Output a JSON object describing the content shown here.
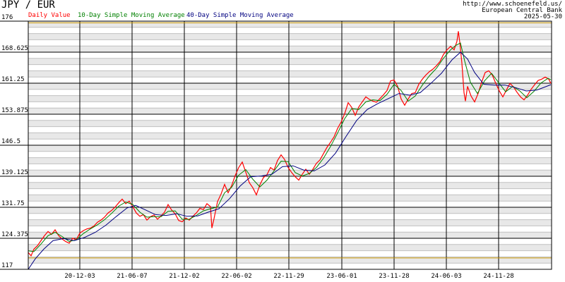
{
  "chart_data": {
    "type": "line",
    "title": "JPY / EUR",
    "source_url": "http://www.schoenefeld.us/",
    "source_name": "European Central Bank",
    "date": "2025-05-30",
    "ylim": [
      117,
      176
    ],
    "y_ticks": [
      "176",
      "168.625",
      "161.25",
      "153.875",
      "146.5",
      "139.125",
      "131.75",
      "124.375",
      "117"
    ],
    "x_ticks": [
      "20-12-03",
      "21-06-07",
      "21-12-02",
      "22-06-02",
      "22-11-29",
      "23-06-01",
      "23-11-28",
      "24-06-03",
      "24-11-28"
    ],
    "reference_lines": [
      175.6,
      119.7
    ],
    "colors": {
      "daily": "#ff0000",
      "sma10": "#008000",
      "sma40": "#000080",
      "grid_major": "#000000",
      "grid_minor": "#c0c0c0",
      "band": "#e8e8e8",
      "reference": "#cc9900"
    },
    "series": [
      {
        "name": "Daily Value",
        "values": [
          [
            0,
            121.0
          ],
          [
            4,
            120.2
          ],
          [
            8,
            121.8
          ],
          [
            13,
            122.6
          ],
          [
            18,
            123.8
          ],
          [
            23,
            125.0
          ],
          [
            28,
            126.0
          ],
          [
            33,
            125.3
          ],
          [
            38,
            126.4
          ],
          [
            43,
            125.0
          ],
          [
            48,
            124.2
          ],
          [
            53,
            123.6
          ],
          [
            58,
            123.2
          ],
          [
            63,
            124.4
          ],
          [
            68,
            124.0
          ],
          [
            73,
            125.6
          ],
          [
            78,
            126.2
          ],
          [
            83,
            126.6
          ],
          [
            88,
            126.8
          ],
          [
            93,
            127.3
          ],
          [
            98,
            128.2
          ],
          [
            103,
            128.7
          ],
          [
            108,
            129.4
          ],
          [
            113,
            130.4
          ],
          [
            118,
            131.0
          ],
          [
            123,
            131.8
          ],
          [
            128,
            132.8
          ],
          [
            133,
            133.7
          ],
          [
            138,
            132.6
          ],
          [
            143,
            133.2
          ],
          [
            148,
            131.9
          ],
          [
            153,
            130.4
          ],
          [
            158,
            129.6
          ],
          [
            163,
            130.0
          ],
          [
            168,
            128.7
          ],
          [
            173,
            129.5
          ],
          [
            178,
            129.9
          ],
          [
            183,
            128.9
          ],
          [
            188,
            129.7
          ],
          [
            193,
            130.6
          ],
          [
            198,
            132.4
          ],
          [
            203,
            131.1
          ],
          [
            208,
            130.2
          ],
          [
            213,
            128.6
          ],
          [
            218,
            128.3
          ],
          [
            223,
            129.2
          ],
          [
            228,
            128.7
          ],
          [
            233,
            129.6
          ],
          [
            238,
            130.4
          ],
          [
            243,
            131.5
          ],
          [
            248,
            131.2
          ],
          [
            253,
            132.6
          ],
          [
            258,
            131.9
          ],
          [
            260,
            126.8
          ],
          [
            263,
            129.0
          ],
          [
            268,
            133.1
          ],
          [
            273,
            134.9
          ],
          [
            278,
            137.2
          ],
          [
            283,
            135.2
          ],
          [
            288,
            136.9
          ],
          [
            293,
            139.3
          ],
          [
            298,
            141.2
          ],
          [
            303,
            142.5
          ],
          [
            308,
            140.1
          ],
          [
            313,
            137.6
          ],
          [
            318,
            136.4
          ],
          [
            323,
            134.7
          ],
          [
            328,
            137.1
          ],
          [
            333,
            138.8
          ],
          [
            338,
            139.5
          ],
          [
            343,
            141.2
          ],
          [
            348,
            140.6
          ],
          [
            353,
            142.9
          ],
          [
            358,
            144.2
          ],
          [
            363,
            143.1
          ],
          [
            368,
            141.2
          ],
          [
            373,
            140.0
          ],
          [
            378,
            139.0
          ],
          [
            383,
            138.2
          ],
          [
            388,
            139.6
          ],
          [
            393,
            140.8
          ],
          [
            398,
            139.6
          ],
          [
            403,
            140.8
          ],
          [
            408,
            142.2
          ],
          [
            413,
            143.0
          ],
          [
            418,
            144.5
          ],
          [
            423,
            146.0
          ],
          [
            428,
            147.2
          ],
          [
            433,
            148.5
          ],
          [
            438,
            150.5
          ],
          [
            443,
            152.0
          ],
          [
            448,
            154.0
          ],
          [
            453,
            156.6
          ],
          [
            458,
            155.5
          ],
          [
            463,
            153.6
          ],
          [
            468,
            155.6
          ],
          [
            473,
            156.8
          ],
          [
            478,
            158.0
          ],
          [
            483,
            157.4
          ],
          [
            488,
            157.0
          ],
          [
            493,
            156.7
          ],
          [
            498,
            157.6
          ],
          [
            503,
            158.5
          ],
          [
            508,
            159.5
          ],
          [
            513,
            161.8
          ],
          [
            518,
            162.0
          ],
          [
            523,
            160.5
          ],
          [
            528,
            157.5
          ],
          [
            533,
            156.0
          ],
          [
            538,
            157.5
          ],
          [
            543,
            158.8
          ],
          [
            548,
            159.0
          ],
          [
            553,
            161.0
          ],
          [
            558,
            162.2
          ],
          [
            563,
            163.2
          ],
          [
            568,
            164.0
          ],
          [
            573,
            164.6
          ],
          [
            578,
            165.4
          ],
          [
            583,
            166.4
          ],
          [
            588,
            168.1
          ],
          [
            593,
            169.2
          ],
          [
            598,
            170.0
          ],
          [
            603,
            169.2
          ],
          [
            607,
            171.2
          ],
          [
            609,
            173.6
          ],
          [
            611,
            171.0
          ],
          [
            614,
            166.0
          ],
          [
            617,
            159.0
          ],
          [
            619,
            157.0
          ],
          [
            622,
            160.5
          ],
          [
            627,
            158.2
          ],
          [
            632,
            156.8
          ],
          [
            637,
            158.8
          ],
          [
            642,
            161.5
          ],
          [
            647,
            163.8
          ],
          [
            652,
            164.2
          ],
          [
            657,
            163.2
          ],
          [
            662,
            161.2
          ],
          [
            667,
            159.4
          ],
          [
            672,
            158.0
          ],
          [
            677,
            159.6
          ],
          [
            682,
            161.2
          ],
          [
            687,
            160.4
          ],
          [
            692,
            159.1
          ],
          [
            697,
            158.0
          ],
          [
            702,
            157.3
          ],
          [
            707,
            158.4
          ],
          [
            712,
            159.8
          ],
          [
            717,
            160.9
          ],
          [
            722,
            161.9
          ],
          [
            727,
            162.2
          ],
          [
            732,
            162.7
          ],
          [
            737,
            162.2
          ],
          [
            740,
            161.2
          ]
        ]
      },
      {
        "name": "10-Day Simple Moving Average",
        "values": [
          [
            0,
            121.4
          ],
          [
            8,
            121.2
          ],
          [
            18,
            123.0
          ],
          [
            28,
            125.0
          ],
          [
            38,
            125.8
          ],
          [
            48,
            124.8
          ],
          [
            58,
            123.6
          ],
          [
            68,
            124.0
          ],
          [
            78,
            125.5
          ],
          [
            88,
            126.6
          ],
          [
            98,
            127.6
          ],
          [
            108,
            128.8
          ],
          [
            118,
            130.3
          ],
          [
            128,
            132.0
          ],
          [
            138,
            133.0
          ],
          [
            148,
            132.4
          ],
          [
            158,
            130.6
          ],
          [
            168,
            129.4
          ],
          [
            178,
            129.5
          ],
          [
            188,
            129.5
          ],
          [
            198,
            130.8
          ],
          [
            208,
            130.9
          ],
          [
            218,
            128.9
          ],
          [
            228,
            128.9
          ],
          [
            238,
            129.8
          ],
          [
            248,
            130.9
          ],
          [
            258,
            131.4
          ],
          [
            268,
            131.8
          ],
          [
            278,
            135.2
          ],
          [
            288,
            136.5
          ],
          [
            298,
            139.4
          ],
          [
            308,
            140.7
          ],
          [
            318,
            138.4
          ],
          [
            328,
            136.6
          ],
          [
            338,
            138.2
          ],
          [
            348,
            140.4
          ],
          [
            358,
            142.7
          ],
          [
            368,
            142.6
          ],
          [
            378,
            140.0
          ],
          [
            388,
            139.2
          ],
          [
            398,
            139.8
          ],
          [
            408,
            141.2
          ],
          [
            418,
            143.4
          ],
          [
            428,
            146.2
          ],
          [
            438,
            149.4
          ],
          [
            448,
            152.8
          ],
          [
            458,
            155.2
          ],
          [
            468,
            155.0
          ],
          [
            478,
            156.8
          ],
          [
            488,
            157.3
          ],
          [
            498,
            157.1
          ],
          [
            508,
            158.6
          ],
          [
            518,
            161.0
          ],
          [
            528,
            159.5
          ],
          [
            538,
            157.0
          ],
          [
            548,
            158.2
          ],
          [
            558,
            160.8
          ],
          [
            568,
            163.0
          ],
          [
            578,
            164.8
          ],
          [
            588,
            167.2
          ],
          [
            598,
            169.2
          ],
          [
            606,
            170.3
          ],
          [
            612,
            170.8
          ],
          [
            618,
            166.5
          ],
          [
            626,
            161.5
          ],
          [
            636,
            158.8
          ],
          [
            646,
            161.8
          ],
          [
            656,
            163.6
          ],
          [
            666,
            161.4
          ],
          [
            676,
            159.2
          ],
          [
            686,
            160.5
          ],
          [
            696,
            159.4
          ],
          [
            706,
            157.8
          ],
          [
            716,
            159.3
          ],
          [
            726,
            161.3
          ],
          [
            736,
            162.4
          ],
          [
            740,
            162.1
          ]
        ]
      },
      {
        "name": "40-Day Simple Moving Average",
        "values": [
          [
            0,
            117.0
          ],
          [
            10,
            119.5
          ],
          [
            22,
            121.8
          ],
          [
            35,
            123.8
          ],
          [
            50,
            124.3
          ],
          [
            65,
            123.8
          ],
          [
            80,
            124.6
          ],
          [
            95,
            125.8
          ],
          [
            110,
            127.5
          ],
          [
            125,
            129.6
          ],
          [
            140,
            131.6
          ],
          [
            152,
            132.2
          ],
          [
            165,
            131.2
          ],
          [
            180,
            130.0
          ],
          [
            195,
            129.8
          ],
          [
            210,
            130.2
          ],
          [
            225,
            129.6
          ],
          [
            240,
            129.7
          ],
          [
            255,
            130.6
          ],
          [
            270,
            131.4
          ],
          [
            285,
            133.8
          ],
          [
            300,
            136.8
          ],
          [
            315,
            139.0
          ],
          [
            330,
            139.2
          ],
          [
            345,
            139.6
          ],
          [
            360,
            141.4
          ],
          [
            375,
            141.6
          ],
          [
            390,
            140.6
          ],
          [
            405,
            140.4
          ],
          [
            420,
            141.8
          ],
          [
            435,
            144.6
          ],
          [
            450,
            148.6
          ],
          [
            465,
            152.4
          ],
          [
            480,
            155.0
          ],
          [
            495,
            156.4
          ],
          [
            510,
            157.6
          ],
          [
            525,
            158.8
          ],
          [
            540,
            158.4
          ],
          [
            555,
            159.0
          ],
          [
            570,
            161.2
          ],
          [
            585,
            163.6
          ],
          [
            600,
            166.8
          ],
          [
            612,
            168.6
          ],
          [
            622,
            167.0
          ],
          [
            632,
            163.8
          ],
          [
            645,
            161.0
          ],
          [
            660,
            160.8
          ],
          [
            675,
            160.8
          ],
          [
            690,
            160.2
          ],
          [
            705,
            159.4
          ],
          [
            720,
            159.6
          ],
          [
            740,
            160.9
          ]
        ]
      }
    ]
  }
}
